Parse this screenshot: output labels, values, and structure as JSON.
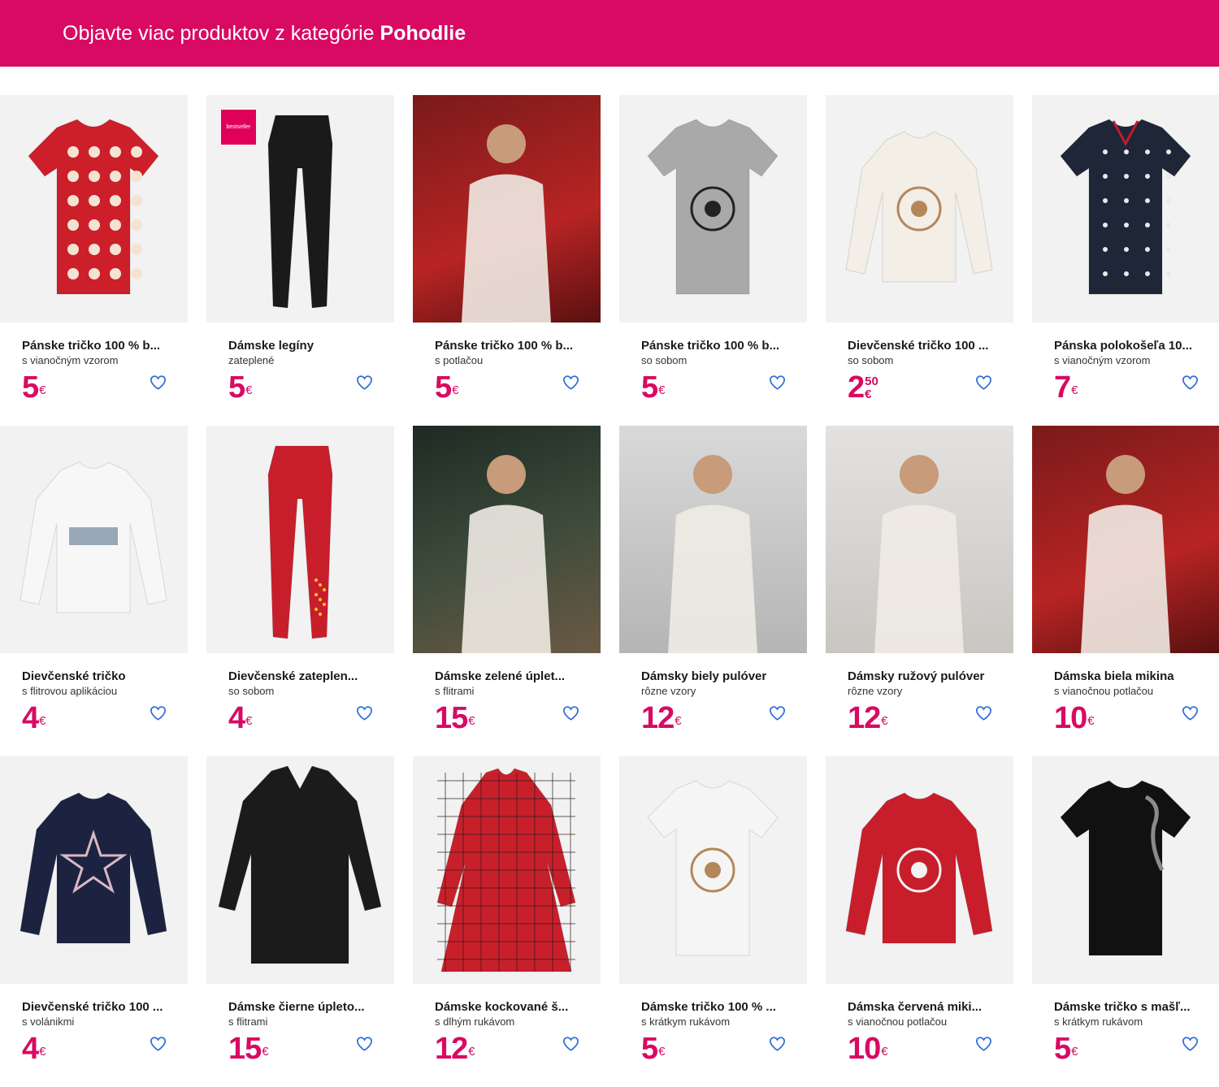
{
  "banner": {
    "prefix": "Objavte viac produktov z kategórie",
    "category": "Pohodlie",
    "background": "#d80a63"
  },
  "colors": {
    "accent": "#d80a63",
    "heart": "#2f6fd8"
  },
  "products": [
    {
      "title": "Pánske tričko 100 % b...",
      "subtitle": "s vianočným vzorom",
      "price_int": "5",
      "price_dec": "",
      "currency": "€",
      "image": "red-santa-tshirt",
      "badge": ""
    },
    {
      "title": "Dámske legíny",
      "subtitle": "zateplené",
      "price_int": "5",
      "price_dec": "",
      "currency": "€",
      "image": "black-leggings",
      "badge": "bestseller"
    },
    {
      "title": "Pánske tričko 100 % b...",
      "subtitle": "s potlačou",
      "price_int": "5",
      "price_dec": "",
      "currency": "€",
      "image": "man-santa-sleigh-photo",
      "badge": ""
    },
    {
      "title": "Pánske tričko 100 % b...",
      "subtitle": "so sobom",
      "price_int": "5",
      "price_dec": "",
      "currency": "€",
      "image": "grey-reindeer-tshirt",
      "badge": ""
    },
    {
      "title": "Dievčenské tričko 100 ...",
      "subtitle": "so sobom",
      "price_int": "2",
      "price_dec": "50",
      "currency": "€",
      "image": "cream-reindeer-longsleeve",
      "badge": ""
    },
    {
      "title": "Pánska polokošeľa 10...",
      "subtitle": "s vianočným vzorom",
      "price_int": "7",
      "price_dec": "",
      "currency": "€",
      "image": "navy-christmas-polo",
      "badge": ""
    },
    {
      "title": "Dievčenské tričko",
      "subtitle": "s flitrovou aplikáciou",
      "price_int": "4",
      "price_dec": "",
      "currency": "€",
      "image": "white-kind-longsleeve",
      "badge": ""
    },
    {
      "title": "Dievčenské zateplen...",
      "subtitle": "so sobom",
      "price_int": "4",
      "price_dec": "",
      "currency": "€",
      "image": "red-reindeer-leggings",
      "badge": ""
    },
    {
      "title": "Dámske zelené úplet...",
      "subtitle": "s flitrami",
      "price_int": "15",
      "price_dec": "",
      "currency": "€",
      "image": "two-women-dresses-photo",
      "badge": ""
    },
    {
      "title": "Dámsky biely pulóver",
      "subtitle": "rôzne vzory",
      "price_int": "12",
      "price_dec": "",
      "currency": "€",
      "image": "woman-white-sweater-photo",
      "badge": ""
    },
    {
      "title": "Dámsky ružový pulóver",
      "subtitle": "rôzne vzory",
      "price_int": "12",
      "price_dec": "",
      "currency": "€",
      "image": "woman-pink-sweater-photo",
      "badge": ""
    },
    {
      "title": "Dámska biela mikina",
      "subtitle": "s vianočnou potlačou",
      "price_int": "10",
      "price_dec": "",
      "currency": "€",
      "image": "woman-santas-bakery-photo",
      "badge": ""
    },
    {
      "title": "Dievčenské tričko 100 ...",
      "subtitle": "s volánikmi",
      "price_int": "4",
      "price_dec": "",
      "currency": "€",
      "image": "navy-star-longsleeve",
      "badge": ""
    },
    {
      "title": "Dámske čierne úpleto...",
      "subtitle": "s flitrami",
      "price_int": "15",
      "price_dec": "",
      "currency": "€",
      "image": "black-knit-dress",
      "badge": ""
    },
    {
      "title": "Dámske kockované š...",
      "subtitle": "s dlhým rukávom",
      "price_int": "12",
      "price_dec": "",
      "currency": "€",
      "image": "red-plaid-dress",
      "badge": ""
    },
    {
      "title": "Dámske tričko 100 % ...",
      "subtitle": "s krátkym rukávom",
      "price_int": "5",
      "price_dec": "",
      "currency": "€",
      "image": "white-cat-tshirt",
      "badge": ""
    },
    {
      "title": "Dámska červená miki...",
      "subtitle": "s vianočnou potlačou",
      "price_int": "10",
      "price_dec": "",
      "currency": "€",
      "image": "red-bakery-sweatshirt",
      "badge": ""
    },
    {
      "title": "Dámske tričko s mašľ...",
      "subtitle": "s krátkym rukávom",
      "price_int": "5",
      "price_dec": "",
      "currency": "€",
      "image": "black-bow-tshirt",
      "badge": ""
    }
  ],
  "product_art": {
    "red-santa-tshirt": {
      "color": "#cc1f2a",
      "shape": "tee",
      "print": "santa-pattern"
    },
    "black-leggings": {
      "color": "#1a1a1a",
      "shape": "leggings",
      "print": ""
    },
    "grey-reindeer-tshirt": {
      "color": "#a9a9a9",
      "shape": "tee",
      "print": "reindeer"
    },
    "cream-reindeer-longsleeve": {
      "color": "#f3eee6",
      "shape": "longsleeve",
      "print": "reindeer-small"
    },
    "navy-christmas-polo": {
      "color": "#1e2638",
      "shape": "polo",
      "print": "dots"
    },
    "white-kind-longsleeve": {
      "color": "#f7f7f7",
      "shape": "longsleeve",
      "print": "kind"
    },
    "red-reindeer-leggings": {
      "color": "#c81e2c",
      "shape": "leggings",
      "print": "stars"
    },
    "navy-star-longsleeve": {
      "color": "#1c2340",
      "shape": "longsleeve",
      "print": "star"
    },
    "black-knit-dress": {
      "color": "#1b1b1b",
      "shape": "sweaterdress",
      "print": ""
    },
    "red-plaid-dress": {
      "color": "#c8202b",
      "shape": "dress",
      "print": "plaid"
    },
    "white-cat-tshirt": {
      "color": "#f5f5f5",
      "shape": "tee",
      "print": "cat"
    },
    "red-bakery-sweatshirt": {
      "color": "#c81e2c",
      "shape": "longsleeve",
      "print": "bakery"
    },
    "black-bow-tshirt": {
      "color": "#111111",
      "shape": "tee",
      "print": "bow"
    }
  }
}
